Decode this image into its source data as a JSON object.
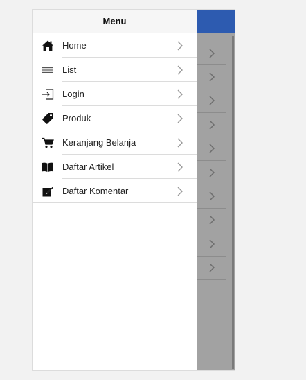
{
  "header": {
    "title": "Menu"
  },
  "menu": {
    "items": [
      {
        "label": "Home",
        "icon": "home-icon"
      },
      {
        "label": "List",
        "icon": "list-icon"
      },
      {
        "label": "Login",
        "icon": "login-icon"
      },
      {
        "label": "Produk",
        "icon": "tag-icon"
      },
      {
        "label": "Keranjang Belanja",
        "icon": "cart-icon"
      },
      {
        "label": "Daftar Artikel",
        "icon": "book-icon"
      },
      {
        "label": "Daftar Komentar",
        "icon": "edit-icon"
      }
    ]
  },
  "colors": {
    "app_header": "#2d5bb0",
    "overlay": "#a2a2a2",
    "panel_header": "#f6f6f6"
  }
}
